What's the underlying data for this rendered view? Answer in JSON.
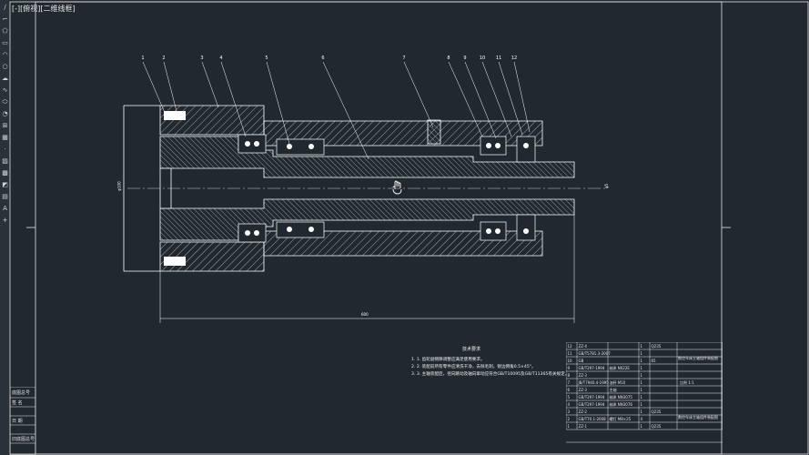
{
  "viewport_label": "[-][俯视][二维线框]",
  "toolbar": [
    {
      "name": "line-tool",
      "glyph": "∕"
    },
    {
      "name": "polyline-tool",
      "glyph": "⌐"
    },
    {
      "name": "polygon-tool",
      "glyph": "⬠"
    },
    {
      "name": "rectangle-tool",
      "glyph": "▭"
    },
    {
      "name": "arc-tool",
      "glyph": "◠"
    },
    {
      "name": "circle-tool",
      "glyph": "○"
    },
    {
      "name": "revcloud-tool",
      "glyph": "☁"
    },
    {
      "name": "spline-tool",
      "glyph": "∿"
    },
    {
      "name": "ellipse-tool",
      "glyph": "⬭"
    },
    {
      "name": "ellipse-arc-tool",
      "glyph": "◔"
    },
    {
      "name": "insert-block-tool",
      "glyph": "⊞"
    },
    {
      "name": "make-block-tool",
      "glyph": "▦"
    },
    {
      "name": "point-tool",
      "glyph": "·"
    },
    {
      "name": "hatch-tool",
      "glyph": "▨"
    },
    {
      "name": "gradient-tool",
      "glyph": "▩"
    },
    {
      "name": "region-tool",
      "glyph": "◩"
    },
    {
      "name": "table-tool",
      "glyph": "▤"
    },
    {
      "name": "mtext-tool",
      "glyph": "A"
    },
    {
      "name": "add-selected-tool",
      "glyph": "+"
    }
  ],
  "balloons": [
    "1",
    "2",
    "3",
    "4",
    "5",
    "6",
    "7",
    "8",
    "9",
    "10",
    "11",
    "12"
  ],
  "dims": {
    "overall_length": "600",
    "left_height": "φ100",
    "right_height": "φ5"
  },
  "notes": {
    "title": "技术要求",
    "lines": [
      "1. 1. 齿轮副侧隙调整应满足使用要求。",
      "2. 2. 装配前所有零件应清洗干净，去除毛刺，锐边倒角0.5×45°。",
      "3. 3. 主轴装配后，径向跳动及轴向窜动应符合GB/T10095及GB/T11365有关规定。"
    ]
  },
  "left_block": [
    "底图总号",
    "签 名",
    "日 期",
    "旧底图总号"
  ],
  "bom": [
    [
      "12",
      "ZZ-4",
      "",
      "1",
      "Q235",
      ""
    ],
    [
      "11",
      "GB/T5781.3-2007",
      "",
      "1",
      "",
      ""
    ],
    [
      "10",
      "GB",
      "",
      "1",
      "65",
      ""
    ],
    [
      "9",
      "GB/T297-1994",
      "轴承 N022E",
      "1",
      "",
      ""
    ],
    [
      "8",
      "ZZ-3",
      "",
      "1",
      "",
      ""
    ],
    [
      "7",
      "JB/T7940.4-1995",
      "油杯 M10",
      "1",
      "",
      ""
    ],
    [
      "6",
      "ZZ-3",
      "主轴",
      "1",
      "",
      ""
    ],
    [
      "5",
      "GB/T297-1994",
      "轴承 NN3075",
      "1",
      "",
      ""
    ],
    [
      "4",
      "GB/T297-1994",
      "轴承 NN3076",
      "1",
      "",
      ""
    ],
    [
      "3",
      "ZZ-2",
      "",
      "1",
      "Q235",
      ""
    ],
    [
      "2",
      "GB/T70.1-2008",
      "螺钉 M8×25",
      "4",
      "",
      ""
    ],
    [
      "1",
      "ZZ-1",
      "",
      "1",
      "Q235",
      ""
    ]
  ],
  "bom_side": [
    "数控车床主轴组件装配图",
    "比例 1:1",
    "数控车床主轴组件装配图"
  ],
  "colors": {
    "bg": "#212830",
    "line": "#ffffff",
    "frame": "#e8e8e8",
    "centerline": "#cfcfcf"
  }
}
